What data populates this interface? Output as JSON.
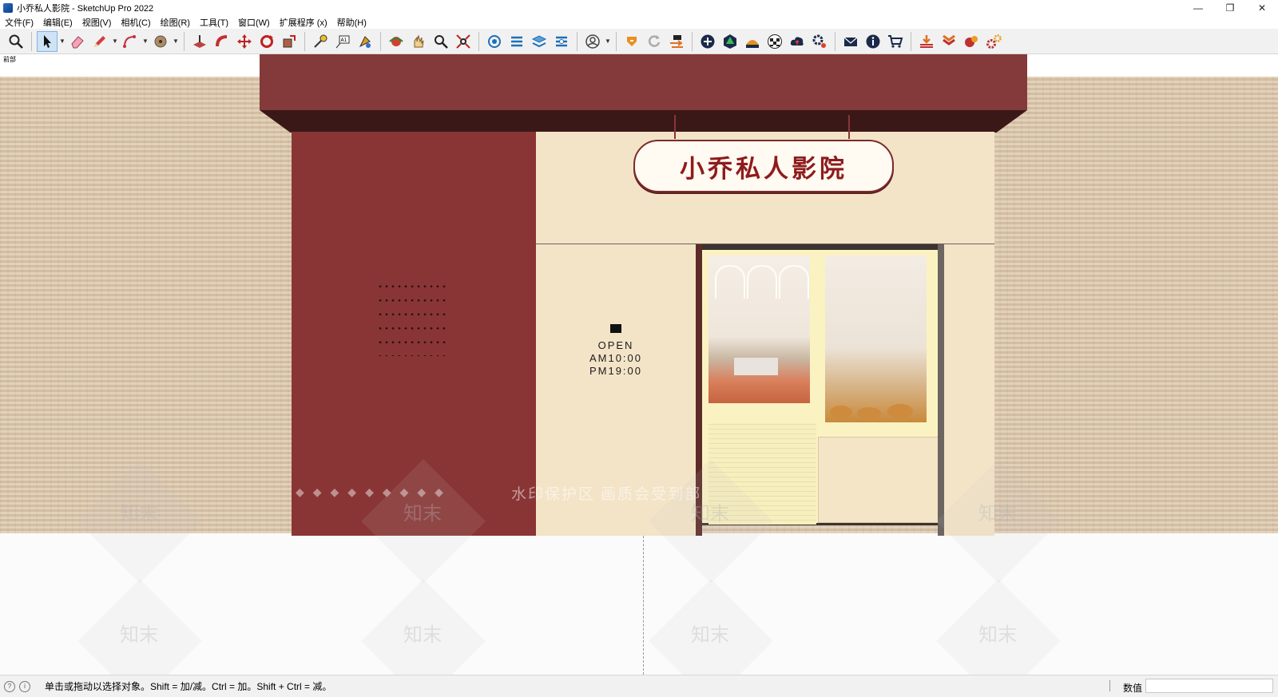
{
  "window": {
    "title": "小乔私人影院 - SketchUp Pro 2022",
    "minimize": "—",
    "restore": "❐",
    "close": "✕"
  },
  "menu": [
    "文件(F)",
    "编辑(E)",
    "视图(V)",
    "相机(C)",
    "绘图(R)",
    "工具(T)",
    "窗口(W)",
    "扩展程序 (x)",
    "帮助(H)"
  ],
  "toolbar": {
    "tools": [
      {
        "name": "zoom-icon"
      },
      {
        "name": "select-icon",
        "active": true
      },
      {
        "name": "eraser-icon"
      },
      {
        "name": "pencil-icon"
      },
      {
        "name": "arc-icon"
      },
      {
        "name": "paint-bucket-icon"
      },
      {
        "name": "push-pull-icon"
      },
      {
        "name": "follow-me-icon"
      },
      {
        "name": "move-icon"
      },
      {
        "name": "rotate-icon"
      },
      {
        "name": "scale-icon"
      },
      {
        "name": "tape-measure-icon"
      },
      {
        "name": "text-icon"
      },
      {
        "name": "paint-icon"
      },
      {
        "name": "orbit-icon"
      },
      {
        "name": "pan-icon"
      },
      {
        "name": "zoom-extents-icon"
      },
      {
        "name": "warehouse-icon"
      },
      {
        "name": "extension-icon"
      },
      {
        "name": "layers-icon"
      },
      {
        "name": "user-icon"
      },
      {
        "name": "plugin-icon"
      },
      {
        "name": "refresh-icon"
      },
      {
        "name": "export-icon"
      },
      {
        "name": "add-icon"
      },
      {
        "name": "tree-icon"
      },
      {
        "name": "chart-icon"
      },
      {
        "name": "checker-icon"
      },
      {
        "name": "cloud-icon"
      },
      {
        "name": "settings-icon"
      },
      {
        "name": "mail-icon"
      },
      {
        "name": "info-icon"
      },
      {
        "name": "cart-icon"
      },
      {
        "name": "download-icon"
      },
      {
        "name": "stack-icon"
      },
      {
        "name": "render-icon"
      },
      {
        "name": "gear-icon"
      }
    ]
  },
  "viewport": {
    "scene_label": "前部",
    "sign_text": "小乔私人影院",
    "open_sign": [
      "OPEN",
      "AM10:00",
      "PM19:00"
    ],
    "watermark_text": "水印保护区   画质会受到部",
    "watermark_diamonds": "◆◆◆◆◆◆◆◆◆",
    "watermark_logo": "知末"
  },
  "statusbar": {
    "hint": "单击或拖动以选择对象。Shift = 加/减。Ctrl = 加。Shift + Ctrl = 减。",
    "measure_label": "数值",
    "measure_value": ""
  },
  "colors": {
    "canopy": "#843a3a",
    "wall_red": "#8a3535",
    "cream": "#f3e4c8",
    "sign_text": "#8e1c1c"
  }
}
